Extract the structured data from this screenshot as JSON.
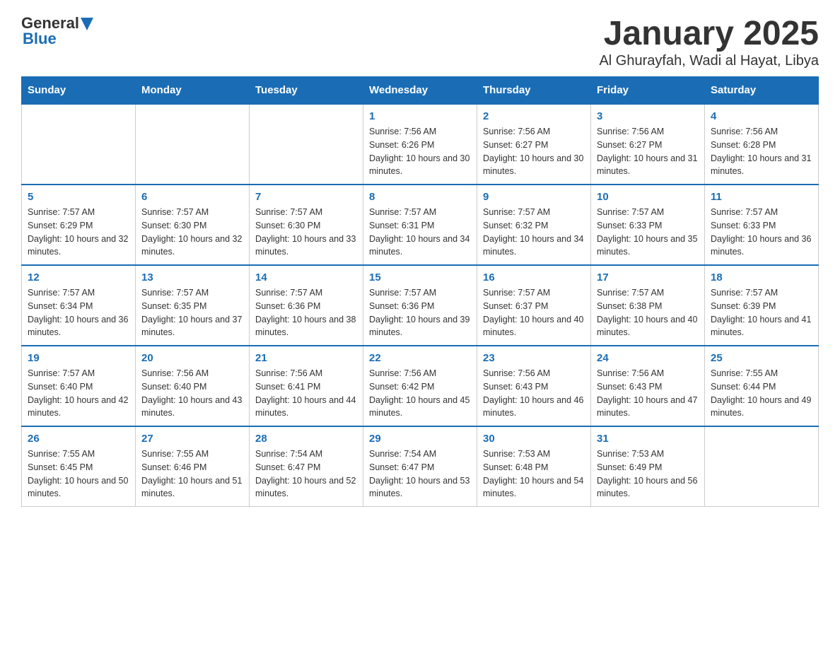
{
  "header": {
    "logo_general": "General",
    "logo_blue": "Blue",
    "title": "January 2025",
    "subtitle": "Al Ghurayfah, Wadi al Hayat, Libya"
  },
  "days_of_week": [
    "Sunday",
    "Monday",
    "Tuesday",
    "Wednesday",
    "Thursday",
    "Friday",
    "Saturday"
  ],
  "weeks": [
    [
      {
        "day": "",
        "info": ""
      },
      {
        "day": "",
        "info": ""
      },
      {
        "day": "",
        "info": ""
      },
      {
        "day": "1",
        "info": "Sunrise: 7:56 AM\nSunset: 6:26 PM\nDaylight: 10 hours and 30 minutes."
      },
      {
        "day": "2",
        "info": "Sunrise: 7:56 AM\nSunset: 6:27 PM\nDaylight: 10 hours and 30 minutes."
      },
      {
        "day": "3",
        "info": "Sunrise: 7:56 AM\nSunset: 6:27 PM\nDaylight: 10 hours and 31 minutes."
      },
      {
        "day": "4",
        "info": "Sunrise: 7:56 AM\nSunset: 6:28 PM\nDaylight: 10 hours and 31 minutes."
      }
    ],
    [
      {
        "day": "5",
        "info": "Sunrise: 7:57 AM\nSunset: 6:29 PM\nDaylight: 10 hours and 32 minutes."
      },
      {
        "day": "6",
        "info": "Sunrise: 7:57 AM\nSunset: 6:30 PM\nDaylight: 10 hours and 32 minutes."
      },
      {
        "day": "7",
        "info": "Sunrise: 7:57 AM\nSunset: 6:30 PM\nDaylight: 10 hours and 33 minutes."
      },
      {
        "day": "8",
        "info": "Sunrise: 7:57 AM\nSunset: 6:31 PM\nDaylight: 10 hours and 34 minutes."
      },
      {
        "day": "9",
        "info": "Sunrise: 7:57 AM\nSunset: 6:32 PM\nDaylight: 10 hours and 34 minutes."
      },
      {
        "day": "10",
        "info": "Sunrise: 7:57 AM\nSunset: 6:33 PM\nDaylight: 10 hours and 35 minutes."
      },
      {
        "day": "11",
        "info": "Sunrise: 7:57 AM\nSunset: 6:33 PM\nDaylight: 10 hours and 36 minutes."
      }
    ],
    [
      {
        "day": "12",
        "info": "Sunrise: 7:57 AM\nSunset: 6:34 PM\nDaylight: 10 hours and 36 minutes."
      },
      {
        "day": "13",
        "info": "Sunrise: 7:57 AM\nSunset: 6:35 PM\nDaylight: 10 hours and 37 minutes."
      },
      {
        "day": "14",
        "info": "Sunrise: 7:57 AM\nSunset: 6:36 PM\nDaylight: 10 hours and 38 minutes."
      },
      {
        "day": "15",
        "info": "Sunrise: 7:57 AM\nSunset: 6:36 PM\nDaylight: 10 hours and 39 minutes."
      },
      {
        "day": "16",
        "info": "Sunrise: 7:57 AM\nSunset: 6:37 PM\nDaylight: 10 hours and 40 minutes."
      },
      {
        "day": "17",
        "info": "Sunrise: 7:57 AM\nSunset: 6:38 PM\nDaylight: 10 hours and 40 minutes."
      },
      {
        "day": "18",
        "info": "Sunrise: 7:57 AM\nSunset: 6:39 PM\nDaylight: 10 hours and 41 minutes."
      }
    ],
    [
      {
        "day": "19",
        "info": "Sunrise: 7:57 AM\nSunset: 6:40 PM\nDaylight: 10 hours and 42 minutes."
      },
      {
        "day": "20",
        "info": "Sunrise: 7:56 AM\nSunset: 6:40 PM\nDaylight: 10 hours and 43 minutes."
      },
      {
        "day": "21",
        "info": "Sunrise: 7:56 AM\nSunset: 6:41 PM\nDaylight: 10 hours and 44 minutes."
      },
      {
        "day": "22",
        "info": "Sunrise: 7:56 AM\nSunset: 6:42 PM\nDaylight: 10 hours and 45 minutes."
      },
      {
        "day": "23",
        "info": "Sunrise: 7:56 AM\nSunset: 6:43 PM\nDaylight: 10 hours and 46 minutes."
      },
      {
        "day": "24",
        "info": "Sunrise: 7:56 AM\nSunset: 6:43 PM\nDaylight: 10 hours and 47 minutes."
      },
      {
        "day": "25",
        "info": "Sunrise: 7:55 AM\nSunset: 6:44 PM\nDaylight: 10 hours and 49 minutes."
      }
    ],
    [
      {
        "day": "26",
        "info": "Sunrise: 7:55 AM\nSunset: 6:45 PM\nDaylight: 10 hours and 50 minutes."
      },
      {
        "day": "27",
        "info": "Sunrise: 7:55 AM\nSunset: 6:46 PM\nDaylight: 10 hours and 51 minutes."
      },
      {
        "day": "28",
        "info": "Sunrise: 7:54 AM\nSunset: 6:47 PM\nDaylight: 10 hours and 52 minutes."
      },
      {
        "day": "29",
        "info": "Sunrise: 7:54 AM\nSunset: 6:47 PM\nDaylight: 10 hours and 53 minutes."
      },
      {
        "day": "30",
        "info": "Sunrise: 7:53 AM\nSunset: 6:48 PM\nDaylight: 10 hours and 54 minutes."
      },
      {
        "day": "31",
        "info": "Sunrise: 7:53 AM\nSunset: 6:49 PM\nDaylight: 10 hours and 56 minutes."
      },
      {
        "day": "",
        "info": ""
      }
    ]
  ]
}
